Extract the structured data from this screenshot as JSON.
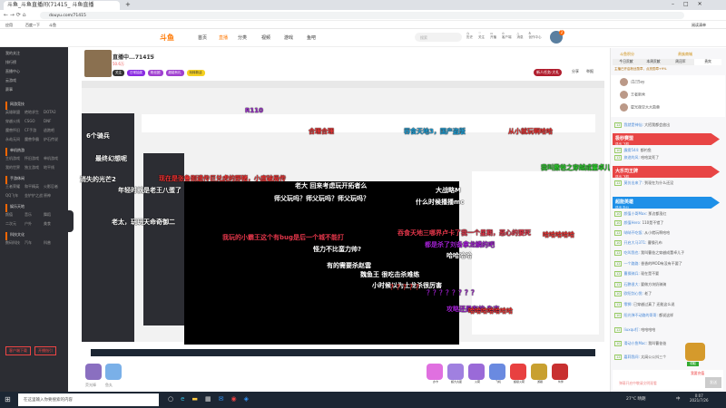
{
  "browser": {
    "tab_title": "斗鱼_斗鱼直播间(71415_ 斗鱼直播",
    "url": "douyu.com/71415",
    "bookmarks": [
      "应用",
      "百度一下",
      "斗鱼"
    ],
    "reading_list": "阅读清单"
  },
  "header": {
    "logo": "斗鱼",
    "nav": [
      "首页",
      "直播",
      "分类",
      "视频",
      "游戏",
      "鱼吧"
    ],
    "search_placeholder": "搜索",
    "icons": [
      {
        "label": "历史",
        "icon": "clock-icon"
      },
      {
        "label": "关注",
        "icon": "heart-icon"
      },
      {
        "label": "开播",
        "icon": "camera-icon"
      },
      {
        "label": "客户端",
        "icon": "download-icon"
      },
      {
        "label": "消息",
        "icon": "bell-icon"
      },
      {
        "label": "创作中心",
        "icon": "bulb-icon"
      }
    ],
    "badge": "2"
  },
  "sidebar": {
    "top": [
      "我的关注",
      "排行榜",
      "直播中心",
      "云游戏",
      "赛事"
    ],
    "sections": [
      {
        "title": "网游竞技",
        "items": [
          "英雄联盟",
          "绝地求生",
          "DOTA2",
          "穿越火线",
          "CSGO",
          "DNF",
          "魔兽怀旧",
          "CF手游",
          "逃跑吧",
          "永劫无间",
          "魔兽争霸",
          "炉石传说"
        ]
      },
      {
        "title": "单机热游",
        "items": [
          "主机游戏",
          "怀旧游戏",
          "单机游戏",
          "我的世界",
          "独立游戏",
          "地平线"
        ]
      },
      {
        "title": "手游休闲",
        "items": [
          "王者荣耀",
          "和平精英",
          "火影忍者",
          "QQ飞车",
          "金铲铲之战",
          "原神"
        ]
      },
      {
        "title": "娱乐天地",
        "items": [
          "颜值",
          "音乐",
          "舞蹈",
          "二次元",
          "户外",
          "美食"
        ]
      },
      {
        "title": "科技文化",
        "items": [
          "数码科技",
          "汽车",
          "科普"
        ]
      }
    ],
    "buttons": [
      "客户端下载",
      "开播指引"
    ]
  },
  "streamer": {
    "title": "直播中...71415",
    "category": "单机",
    "follow": "关注",
    "fans": "50.6万",
    "tags": [
      "日常抽奖",
      "粉丝团",
      "超能有礼",
      "玩转新活"
    ],
    "task_button": "新人任务·大礼",
    "share": "分享",
    "report": "举报"
  },
  "danmaku": [
    {
      "t": "6个骑兵",
      "c": "#fff"
    },
    {
      "t": "最终幻想呢",
      "c": "#fff"
    },
    {
      "t": "消失的光芒2",
      "c": "#fff"
    },
    {
      "t": "年轻时就是老王八蛋了",
      "c": "#fff"
    },
    {
      "t": "老太，玩玩天命奇御二",
      "c": "#fff"
    },
    {
      "t": "R110",
      "c": "#9a2ec8"
    },
    {
      "t": "合理合理",
      "c": "#e33"
    },
    {
      "t": "吞食天地3，国产盗版",
      "c": "#1ea0d8"
    },
    {
      "t": "从小就玩啊哈哈",
      "c": "#e33"
    },
    {
      "t": "现在是张鲁刚遗传巨兑虎的野猪，小度破局传",
      "c": "#e33"
    },
    {
      "t": "老大 回来考虑玩开拓者么",
      "c": "#fff"
    },
    {
      "t": "师父玩吗？师父玩吗？师父玩吗？",
      "c": "#fff"
    },
    {
      "t": "大战略M",
      "c": "#fff"
    },
    {
      "t": "什么时候播播mc",
      "c": "#fff"
    },
    {
      "t": "吞食天地三哪界卢卡了我一个星期，恶心的要死",
      "c": "#e3364a"
    },
    {
      "t": "都是杀了刘备拿龙鳞的吧",
      "c": "#a020d0"
    },
    {
      "t": "我玩的小霸王这个有bug是后一个城不能打",
      "c": "#e3364a"
    },
    {
      "t": "哈哈哈哈",
      "c": "#fff"
    },
    {
      "t": "怪力不比蛮力帅?",
      "c": "#fff"
    },
    {
      "t": "有的需要杀赵雲",
      "c": "#fff"
    },
    {
      "t": "魏鱼王 很吃击杀难练",
      "c": "#fff"
    },
    {
      "t": "小时候以为土龙杀很厉害",
      "c": "#fff"
    },
    {
      "t": "攻略还是有的 杂志",
      "c": "#a020d0"
    },
    {
      "t": "哈哈哈哈哈哈哈",
      "c": "#e33"
    },
    {
      "t": "我叫撒爸之穿越成董卓儿子",
      "c": "#2ec82e"
    },
    {
      "t": "太阔立",
      "c": "#e33"
    },
    {
      "t": "哈哈哈哈哈",
      "c": "#e33"
    },
    {
      "t": "？？？？？？？？",
      "c": "#a020d0"
    },
    {
      "t": "？？？？？",
      "c": "#e33"
    }
  ],
  "chat": {
    "header_links": [
      "斗鱼积分",
      "贵族商城"
    ],
    "tabs": [
      "今日贡献",
      "本周贡献",
      "周冠军",
      "贵宾"
    ],
    "notice": "主播已开启粉丝勋章，点亮勋章+9%",
    "rank": [
      {
        "name": "戊己Say"
      },
      {
        "name": "王者新秀"
      },
      {
        "name": "星光夜空大大勋章"
      }
    ],
    "banners": [
      {
        "title": "极秒赛盟",
        "sub": "送出 飞机",
        "color": "#e84545"
      },
      {
        "title": "大乐司王牌",
        "sub": "送出 飞机",
        "color": "#e84545"
      },
      {
        "title": "超能英雄",
        "sub": "送出 办公",
        "color": "#1e90e8"
      }
    ],
    "messages": [
      {
        "lvl": "12",
        "user": "我就是神仙:",
        "text": "大招我都会放出"
      },
      {
        "lvl": "10",
        "user": "霹雳544:",
        "text": "都钓鱼"
      },
      {
        "lvl": "12",
        "user": "旅途的风:",
        "text": "哈哈笑死了"
      },
      {
        "lvl": "12",
        "user": "莫仿出来了:",
        "text": "到现在为什么还没"
      },
      {
        "lvl": "10",
        "user": "颜值小哥Max:",
        "text": "那边都涨红"
      },
      {
        "lvl": "10",
        "user": "颜值Hero:",
        "text": "110是不错了"
      },
      {
        "lvl": "12",
        "user": "呐呐不吃饭:",
        "text": "从小就玩啊哈哈"
      },
      {
        "lvl": "10",
        "user": "开启大马371:",
        "text": "曹操孔布"
      },
      {
        "lvl": "12",
        "user": "吃叫我也:",
        "text": "我叫曹爸之穿越成董卓儿子"
      },
      {
        "lvl": "12",
        "user": "一个路路:",
        "text": "香香的MOD有没有不要了"
      },
      {
        "lvl": "12",
        "user": "曹操骑兵:",
        "text": "现在是不要"
      },
      {
        "lvl": "12",
        "user": "石鹏很大:",
        "text": "要做方块奶骑骑"
      },
      {
        "lvl": "10",
        "user": "欧阳剑心悦:",
        "text": "老了"
      },
      {
        "lvl": "12",
        "user": "零狮:",
        "text": "已穿越过真了 还能这么说"
      },
      {
        "lvl": "10",
        "user": "阳光弹不动路的哥哥:",
        "text": "都说这样"
      },
      {
        "lvl": "12",
        "user": "liuxqu钉:",
        "text": "哈哈哈哈"
      },
      {
        "lvl": "10",
        "user": "滑动小鱼Mac:",
        "text": "我叫曹爸爸"
      },
      {
        "lvl": "12",
        "user": "嘉莉我间:",
        "text": "太阔公公抖三个"
      }
    ],
    "chest_label": "领取",
    "input_placeholder": "弹幕开启中敬请文明观看",
    "send": "发送",
    "recharge": "我要充值"
  },
  "gifts": [
    "荧光棒",
    "鱼丸",
    "办卡",
    "超大丸星",
    "火箭",
    "飞机",
    "超级火箭",
    "游艇",
    "伙伴"
  ],
  "taskbar": {
    "search": "在这里输入你要搜索的内容",
    "weather": "27°C 晴朗",
    "time": "0:07",
    "date": "2021/7/26",
    "lang": "中"
  },
  "colors": {
    "brand": "#ff7700",
    "sidebar": "#2c2d33",
    "taskbar": "#1c2633"
  }
}
